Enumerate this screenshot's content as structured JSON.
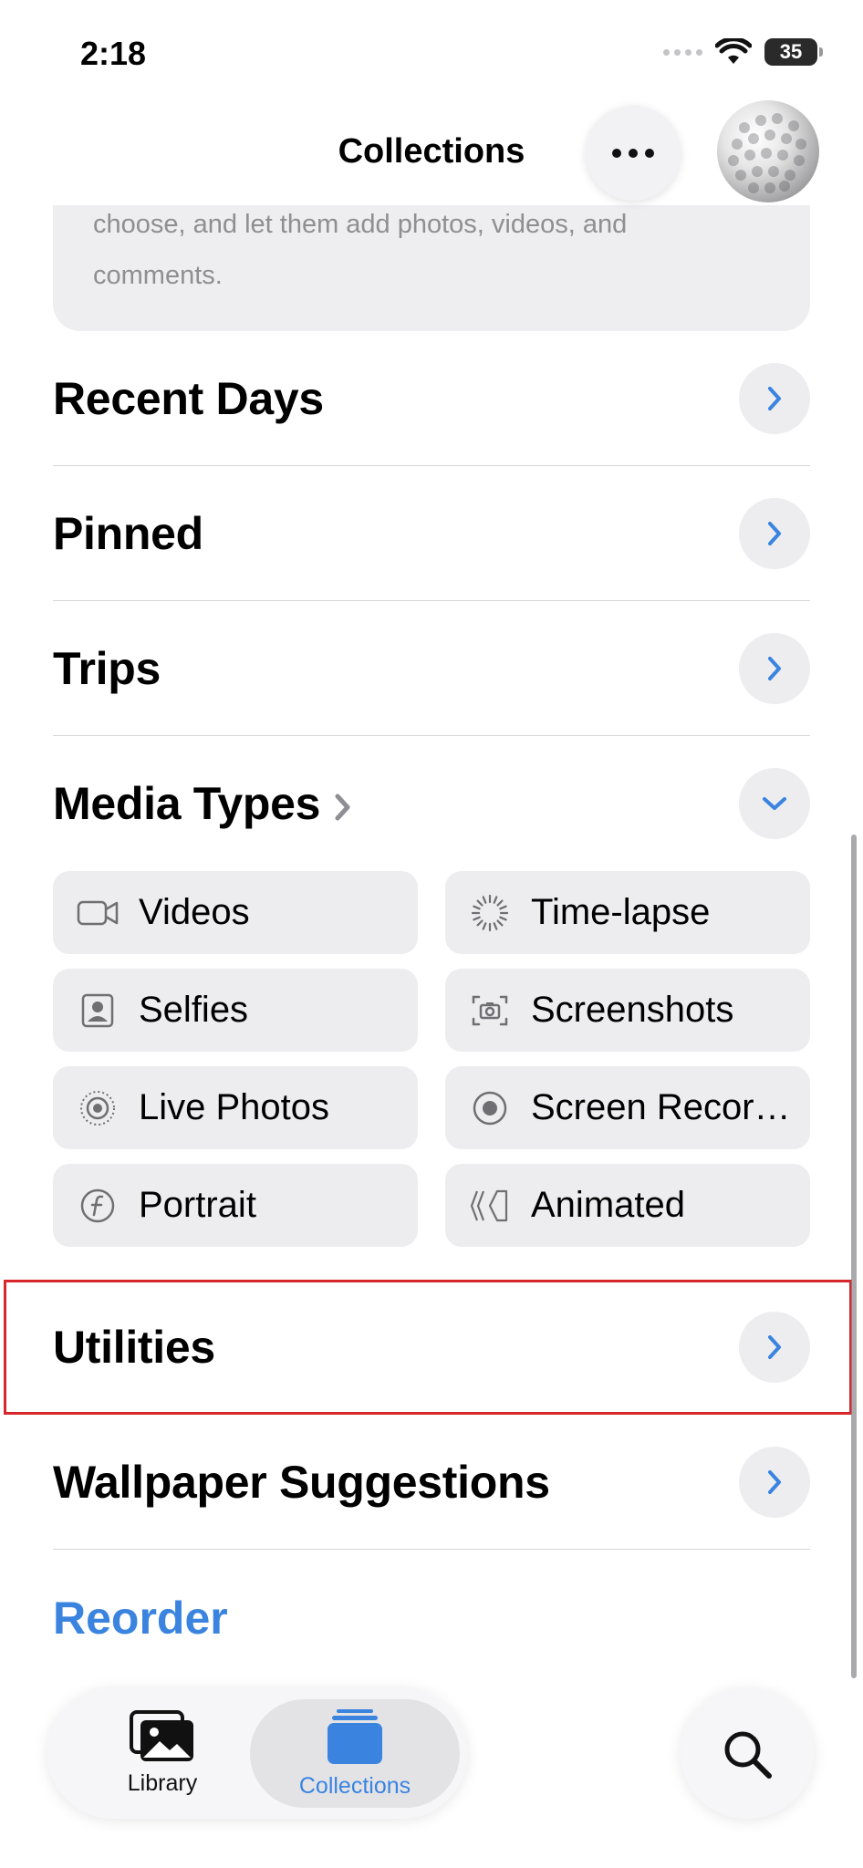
{
  "status_bar": {
    "time": "2:18",
    "battery": "35"
  },
  "header": {
    "title": "Collections"
  },
  "card": {
    "text": "choose, and let them add photos, videos, and comments."
  },
  "sections": {
    "recent_days": "Recent Days",
    "pinned": "Pinned",
    "trips": "Trips",
    "media_types": "Media Types",
    "utilities": "Utilities",
    "wallpaper": "Wallpaper Suggestions"
  },
  "media_types": [
    {
      "label": "Videos",
      "icon": "video-camera-icon"
    },
    {
      "label": "Time-lapse",
      "icon": "time-lapse-icon"
    },
    {
      "label": "Selfies",
      "icon": "selfie-portrait-icon"
    },
    {
      "label": "Screenshots",
      "icon": "screenshot-camera-icon"
    },
    {
      "label": "Live Photos",
      "icon": "live-photo-icon"
    },
    {
      "label": "Screen Recor…",
      "icon": "screen-record-icon"
    },
    {
      "label": "Portrait",
      "icon": "portrait-f-icon"
    },
    {
      "label": "Animated",
      "icon": "animated-layers-icon"
    }
  ],
  "reorder_label": "Reorder",
  "tabbar": {
    "library_label": "Library",
    "collections_label": "Collections"
  },
  "colors": {
    "accent": "#3a84e0",
    "highlight": "#d7262c",
    "tile_bg": "#ededf0"
  }
}
